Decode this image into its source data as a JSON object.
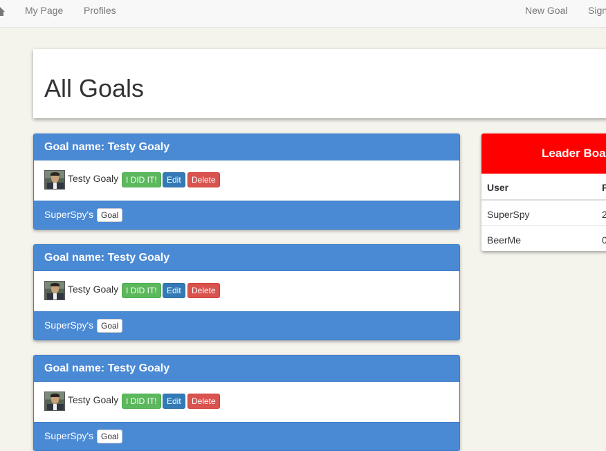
{
  "nav": {
    "left": [
      "My Page",
      "Profiles"
    ],
    "right": [
      "New Goal",
      "Sign"
    ]
  },
  "jumbotron": {
    "title": "All Goals"
  },
  "goals": [
    {
      "name": "Goal name: Testy Goaly",
      "user": "Testy Goaly",
      "did_it": "I DID IT!",
      "edit": "Edit",
      "delete": "Delete",
      "owner": "SuperSpy's",
      "badge": "Goal"
    },
    {
      "name": "Goal name: Testy Goaly",
      "user": "Testy Goaly",
      "did_it": "I DID IT!",
      "edit": "Edit",
      "delete": "Delete",
      "owner": "SuperSpy's",
      "badge": "Goal"
    },
    {
      "name": "Goal name: Testy Goaly",
      "user": "Testy Goaly",
      "did_it": "I DID IT!",
      "edit": "Edit",
      "delete": "Delete",
      "owner": "SuperSpy's",
      "badge": "Goal"
    }
  ],
  "leaderboard": {
    "title": "Leader Boa",
    "columns": [
      "User",
      "P"
    ],
    "rows": [
      {
        "user": "SuperSpy",
        "points": "2"
      },
      {
        "user": "BeerMe",
        "points": "0"
      }
    ]
  },
  "colors": {
    "panel_blue": "#4a89d4",
    "leader_red": "#ff0000",
    "success": "#5cb85c",
    "primary": "#337ab7",
    "danger": "#d9534f"
  }
}
